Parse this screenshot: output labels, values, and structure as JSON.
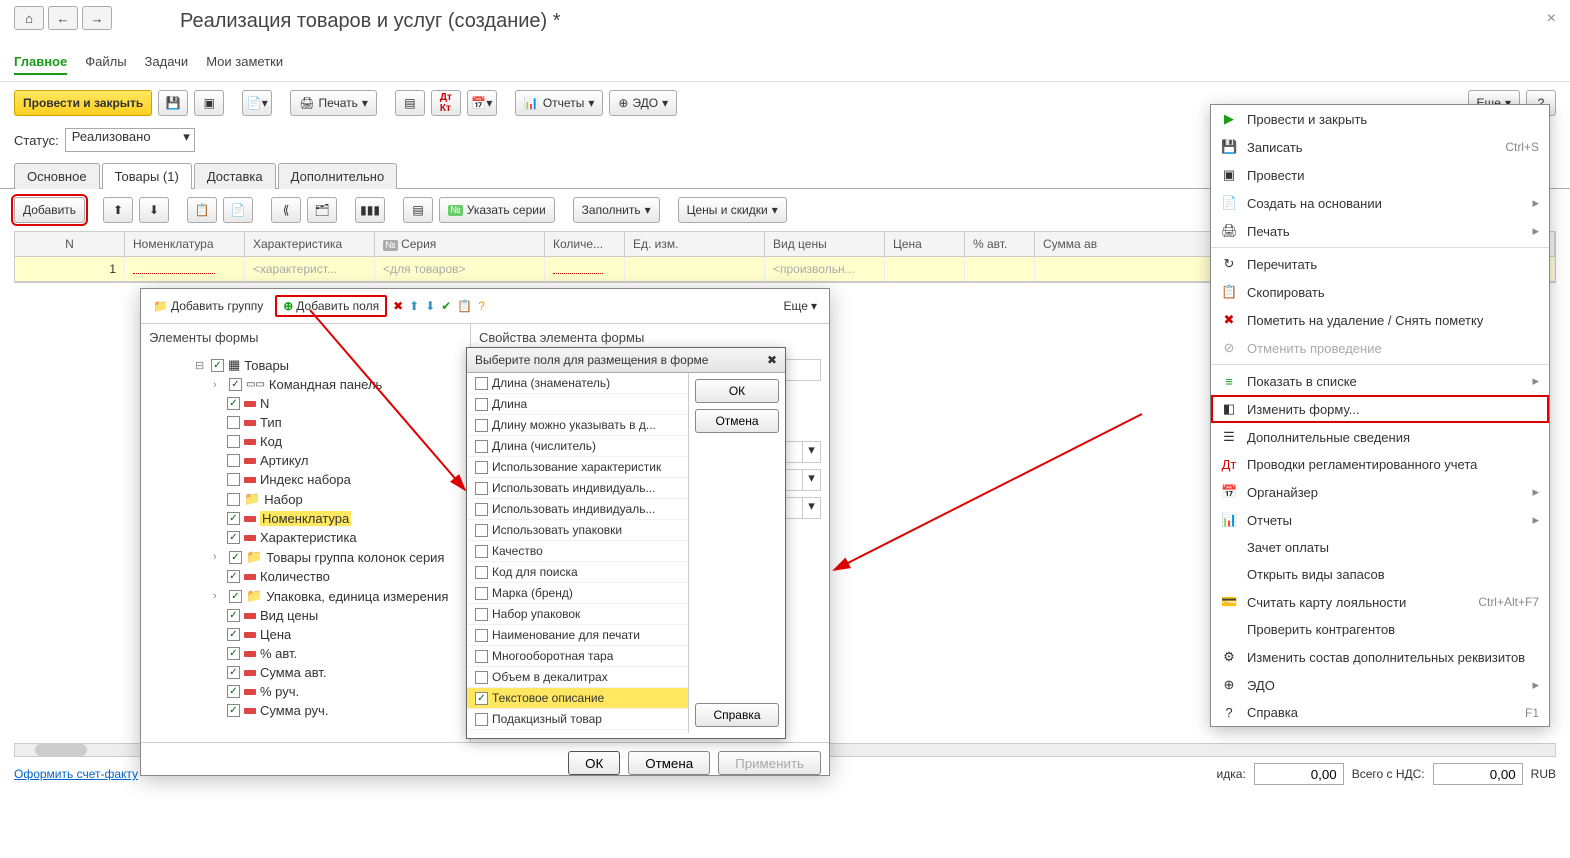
{
  "title": "Реализация товаров и услуг (создание) *",
  "nav_tabs": [
    "Главное",
    "Файлы",
    "Задачи",
    "Мои заметки"
  ],
  "toolbar": {
    "post_close": "Провести и закрыть",
    "print": "Печать",
    "reports": "Отчеты",
    "edo": "ЭДО",
    "more": "Еще"
  },
  "status_label": "Статус:",
  "status_value": "Реализовано",
  "inner_tabs": [
    "Основное",
    "Товары (1)",
    "Доставка",
    "Дополнительно"
  ],
  "toolbar2": {
    "add": "Добавить",
    "series": "Указать серии",
    "fill": "Заполнить",
    "prices": "Цены и скидки"
  },
  "table": {
    "headers": [
      "N",
      "Номенклатура",
      "Характеристика",
      "Серия",
      "Количе...",
      "Ед. изм.",
      "Вид цены",
      "Цена",
      "% авт.",
      "Сумма ав"
    ],
    "row": {
      "n": "1",
      "char": "<характерист...",
      "series": "<для товаров>",
      "price_type": "<произвольн..."
    }
  },
  "dialog": {
    "add_group": "Добавить группу",
    "add_fields": "Добавить поля",
    "more": "Еще",
    "left_title": "Элементы формы",
    "right_title": "Свойства элемента формы",
    "tree": [
      {
        "label": "Товары",
        "checked": true,
        "indent": 1,
        "type": "table",
        "toggle": "⊟"
      },
      {
        "label": "Командная панель",
        "checked": true,
        "indent": 2,
        "type": "cmd",
        "toggle": "›"
      },
      {
        "label": "N",
        "checked": true,
        "indent": 3,
        "type": "field"
      },
      {
        "label": "Тип",
        "checked": false,
        "indent": 3,
        "type": "field"
      },
      {
        "label": "Код",
        "checked": false,
        "indent": 3,
        "type": "field"
      },
      {
        "label": "Артикул",
        "checked": false,
        "indent": 3,
        "type": "field"
      },
      {
        "label": "Индекс набора",
        "checked": false,
        "indent": 3,
        "type": "field"
      },
      {
        "label": "Набор",
        "checked": false,
        "indent": 3,
        "type": "folder"
      },
      {
        "label": "Номенклатура",
        "checked": true,
        "indent": 3,
        "type": "field",
        "highlight": true
      },
      {
        "label": "Характеристика",
        "checked": true,
        "indent": 3,
        "type": "field"
      },
      {
        "label": "Товары группа колонок серия",
        "checked": true,
        "indent": 2,
        "type": "folder",
        "toggle": "›"
      },
      {
        "label": "Количество",
        "checked": true,
        "indent": 3,
        "type": "field"
      },
      {
        "label": "Упаковка, единица измерения",
        "checked": true,
        "indent": 2,
        "type": "folder",
        "toggle": "›"
      },
      {
        "label": "Вид цены",
        "checked": true,
        "indent": 3,
        "type": "field"
      },
      {
        "label": "Цена",
        "checked": true,
        "indent": 3,
        "type": "field"
      },
      {
        "label": "% авт.",
        "checked": true,
        "indent": 3,
        "type": "field"
      },
      {
        "label": "Сумма авт.",
        "checked": true,
        "indent": 3,
        "type": "field"
      },
      {
        "label": "% руч.",
        "checked": true,
        "indent": 3,
        "type": "field"
      },
      {
        "label": "Сумма руч.",
        "checked": true,
        "indent": 3,
        "type": "field"
      }
    ],
    "ok": "ОК",
    "cancel": "Отмена",
    "apply": "Применить"
  },
  "popup2": {
    "title": "Выберите поля для размещения в форме",
    "items": [
      {
        "label": "Длина (знаменатель)",
        "checked": false
      },
      {
        "label": "Длина",
        "checked": false
      },
      {
        "label": "Длину можно указывать в д...",
        "checked": false
      },
      {
        "label": "Длина (числитель)",
        "checked": false
      },
      {
        "label": "Использование характеристик",
        "checked": false
      },
      {
        "label": "Использовать индивидуаль...",
        "checked": false
      },
      {
        "label": "Использовать индивидуаль...",
        "checked": false
      },
      {
        "label": "Использовать упаковки",
        "checked": false
      },
      {
        "label": "Качество",
        "checked": false
      },
      {
        "label": "Код для поиска",
        "checked": false
      },
      {
        "label": "Марка (бренд)",
        "checked": false
      },
      {
        "label": "Набор упаковок",
        "checked": false
      },
      {
        "label": "Наименование для печати",
        "checked": false
      },
      {
        "label": "Многооборотная тара",
        "checked": false
      },
      {
        "label": "Объем в декалитрах",
        "checked": false
      },
      {
        "label": "Текстовое описание",
        "checked": true,
        "selected": true
      },
      {
        "label": "Подакцизный товар",
        "checked": false
      }
    ],
    "ok": "ОК",
    "cancel": "Отмена",
    "help": "Справка"
  },
  "menu": [
    {
      "icon": "▶",
      "label": "Провести и закрыть",
      "color": "#1a9c1a"
    },
    {
      "icon": "💾",
      "label": "Записать",
      "shortcut": "Ctrl+S"
    },
    {
      "icon": "▣",
      "label": "Провести"
    },
    {
      "icon": "📄",
      "label": "Создать на основании",
      "submenu": true,
      "color": "#1a9c1a"
    },
    {
      "icon": "🖨",
      "label": "Печать",
      "submenu": true
    },
    {
      "sep": true
    },
    {
      "icon": "↻",
      "label": "Перечитать"
    },
    {
      "icon": "📋",
      "label": "Скопировать"
    },
    {
      "icon": "✖",
      "label": "Пометить на удаление / Снять пометку",
      "color": "#c00"
    },
    {
      "icon": "⊘",
      "label": "Отменить проведение",
      "disabled": true
    },
    {
      "sep": true
    },
    {
      "icon": "≡",
      "label": "Показать в списке",
      "submenu": true,
      "color": "#1a9c1a"
    },
    {
      "icon": "◧",
      "label": "Изменить форму...",
      "outlined": true
    },
    {
      "icon": "☰",
      "label": "Дополнительные сведения"
    },
    {
      "icon": "Дт",
      "label": "Проводки регламентированного учета",
      "color": "#c00"
    },
    {
      "icon": "📅",
      "label": "Органайзер",
      "submenu": true
    },
    {
      "icon": "📊",
      "label": "Отчеты",
      "submenu": true
    },
    {
      "icon": "",
      "label": "Зачет оплаты"
    },
    {
      "icon": "",
      "label": "Открыть виды запасов"
    },
    {
      "icon": "💳",
      "label": "Считать карту лояльности",
      "shortcut": "Ctrl+Alt+F7"
    },
    {
      "icon": "",
      "label": "Проверить контрагентов"
    },
    {
      "icon": "⚙",
      "label": "Изменить состав дополнительных реквизитов"
    },
    {
      "icon": "⊕",
      "label": "ЭДО",
      "submenu": true
    },
    {
      "icon": "?",
      "label": "Справка",
      "shortcut": "F1"
    }
  ],
  "footer": {
    "invoice_link": "Оформить счет-факту",
    "discount": "идка:",
    "discount_val": "0,00",
    "total_label": "Всего с НДС:",
    "total_val": "0,00",
    "currency": "RUB"
  }
}
